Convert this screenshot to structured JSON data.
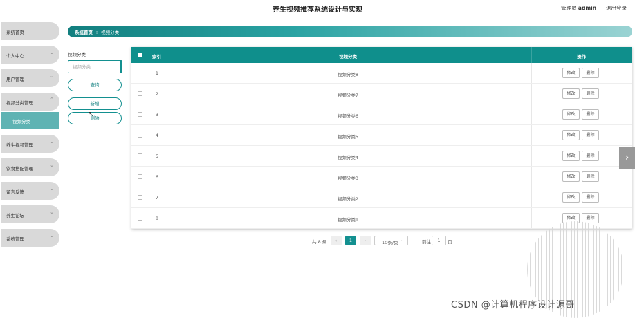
{
  "header": {
    "title": "养生视频推荐系统设计与实现",
    "user_label": "管理员",
    "user_name": "admin",
    "logout": "退出登录"
  },
  "sidebar": {
    "items": [
      {
        "label": "系统首页"
      },
      {
        "label": "个人中心"
      },
      {
        "label": "用户管理"
      },
      {
        "label": "视频分类管理"
      },
      {
        "label": "养生视频管理"
      },
      {
        "label": "饮食搭配管理"
      },
      {
        "label": "留言反馈"
      },
      {
        "label": "养生论坛"
      },
      {
        "label": "系统管理"
      }
    ],
    "sub_item": "视频分类"
  },
  "breadcrumb": {
    "home": "系统首页",
    "current": "视频分类"
  },
  "search": {
    "label": "视频分类",
    "placeholder": "视频分类",
    "query_btn": "查询",
    "add_btn": "新增",
    "delete_btn": "删除"
  },
  "table": {
    "columns": [
      "索引",
      "视频分类",
      "操作"
    ],
    "edit_label": "修改",
    "delete_label": "删除",
    "rows": [
      {
        "index": "1",
        "name": "视频分类8"
      },
      {
        "index": "2",
        "name": "视频分类7"
      },
      {
        "index": "3",
        "name": "视频分类6"
      },
      {
        "index": "4",
        "name": "视频分类5"
      },
      {
        "index": "5",
        "name": "视频分类4"
      },
      {
        "index": "6",
        "name": "视频分类3"
      },
      {
        "index": "7",
        "name": "视频分类2"
      },
      {
        "index": "8",
        "name": "视频分类1"
      }
    ]
  },
  "pagination": {
    "total": "共 8 条",
    "prev": "‹",
    "current_page": "1",
    "next": "›",
    "page_size": "10条/页",
    "goto_label": "前往",
    "goto_value": "1",
    "page_suffix": "页"
  },
  "watermark": "CSDN @计算机程序设计源哥",
  "colors": {
    "primary": "#139090",
    "header_bg": "#0f8f8c",
    "sidebar_item": "#d9d9d9",
    "sub_active": "#5fb3b3"
  }
}
